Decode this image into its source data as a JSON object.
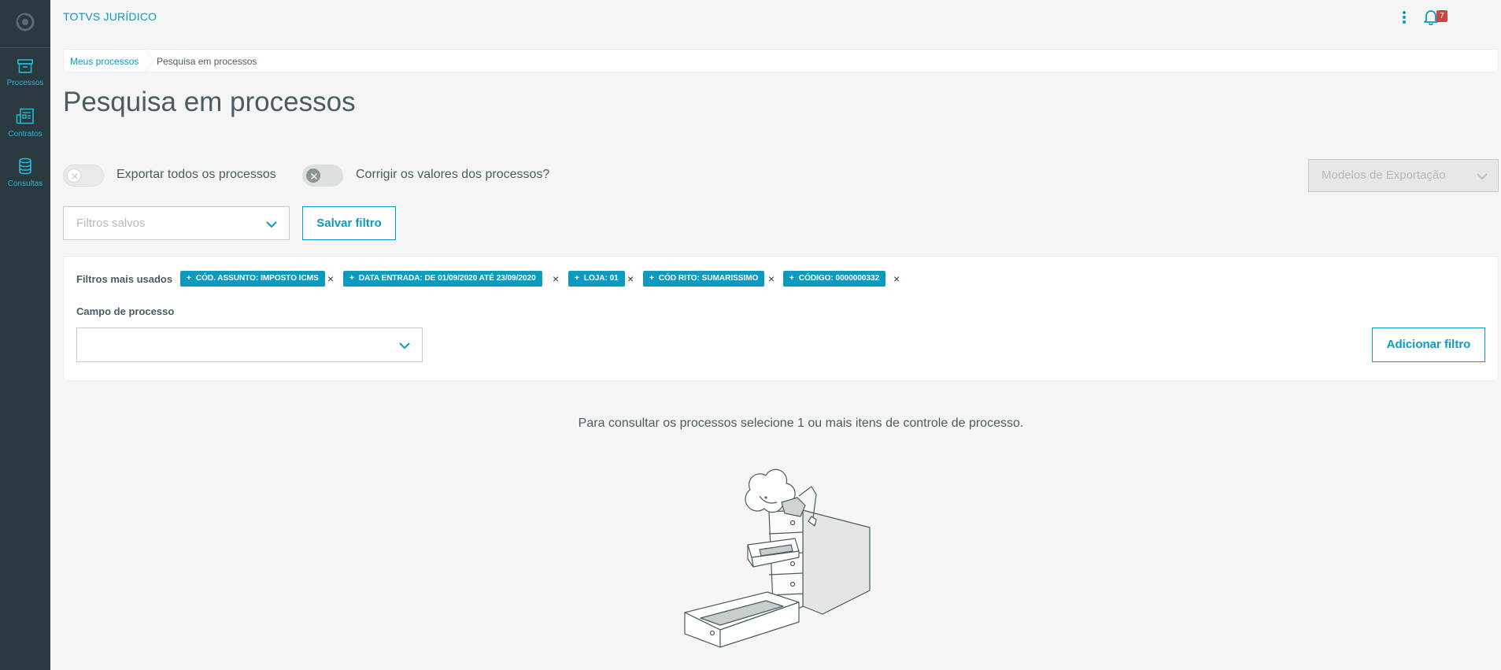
{
  "header": {
    "app_title": "TOTVS JURÍDICO",
    "notification_count": "7"
  },
  "sidebar": {
    "items": [
      {
        "label": "Processos",
        "icon": "archive-icon"
      },
      {
        "label": "Contratos",
        "icon": "contracts-icon"
      },
      {
        "label": "Consultas",
        "icon": "database-icon"
      }
    ]
  },
  "breadcrumb": {
    "items": [
      "Meus processos",
      "Pesquisa em processos"
    ]
  },
  "page": {
    "title": "Pesquisa em processos"
  },
  "options": {
    "export_all_label": "Exportar todos os processos",
    "fix_values_label": "Corrigir os valores dos processos?",
    "export_models_placeholder": "Modelos de Exportação",
    "saved_filters_placeholder": "Filtros salvos",
    "save_filter_label": "Salvar filtro"
  },
  "filters": {
    "title": "Filtros mais usados",
    "chips": [
      "CÓD. ASSUNTO: IMPOSTO ICMS",
      "DATA ENTRADA: DE 01/09/2020 ATÉ 23/09/2020",
      "LOJA: 01",
      "CÓD RITO: SUMARISSIMO",
      "CÓDIGO: 0000000332"
    ],
    "chip_prefix": "+",
    "remove_glyph": "×",
    "field_label": "Campo de processo",
    "field_value": "",
    "add_filter_label": "Adicionar filtro"
  },
  "empty_state": {
    "message": "Para consultar os processos selecione 1 ou mais itens de controle de processo."
  },
  "colors": {
    "primary": "#0c9abe",
    "sidebar": "#29393e",
    "badge": "#c64840"
  }
}
